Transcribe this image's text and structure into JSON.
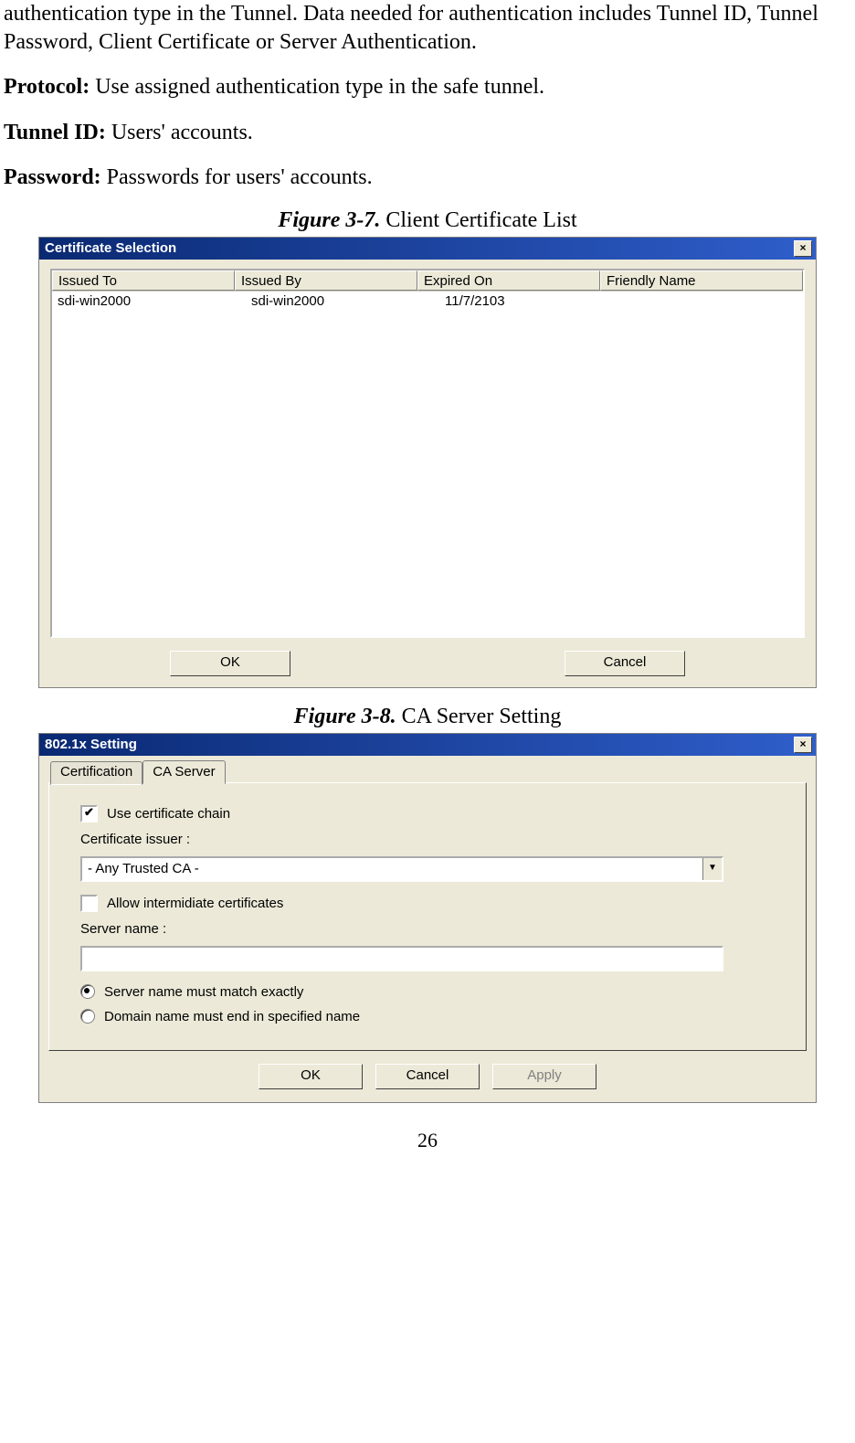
{
  "intro_text": "authentication type in the Tunnel. Data needed for authentication includes Tunnel ID, Tunnel Password, Client Certificate or Server Authentication.",
  "defs": {
    "protocol_label": "Protocol:",
    "protocol_text": " Use assigned authentication type in the safe tunnel.",
    "tunnel_id_label": "Tunnel ID:",
    "tunnel_id_text": " Users' accounts.",
    "password_label": "Password:",
    "password_text": " Passwords for users' accounts."
  },
  "fig1": {
    "label": "Figure 3-7.",
    "caption": "    Client Certificate List"
  },
  "dialog1": {
    "title": "Certificate Selection",
    "close_glyph": "×",
    "headers": {
      "h1": "Issued To",
      "h2": "Issued By",
      "h3": "Expired On",
      "h4": "Friendly Name"
    },
    "rows": [
      {
        "issued_to": "sdi-win2000",
        "issued_by": "sdi-win2000",
        "expired_on": "11/7/2103",
        "friendly_name": ""
      }
    ],
    "ok_label": "OK",
    "cancel_label": "Cancel"
  },
  "fig2": {
    "label": "Figure 3-8.",
    "caption": "    CA Server Setting"
  },
  "dialog2": {
    "title": "802.1x Setting",
    "close_glyph": "×",
    "tabs": {
      "certification": "Certification",
      "ca_server": "CA Server"
    },
    "use_chain_checked_glyph": "✔",
    "use_chain_label": "Use certificate chain",
    "cert_issuer_label": "Certificate issuer :",
    "issuer_value": "- Any Trusted CA -",
    "allow_intermediate_label": "Allow intermidiate certificates",
    "server_name_label": "Server name :",
    "server_name_value": "",
    "radio_match_label": "Server name must match exactly",
    "radio_end_label": "Domain name must end in specified name",
    "ok_label": "OK",
    "cancel_label": "Cancel",
    "apply_label": "Apply"
  },
  "page_number": "26"
}
